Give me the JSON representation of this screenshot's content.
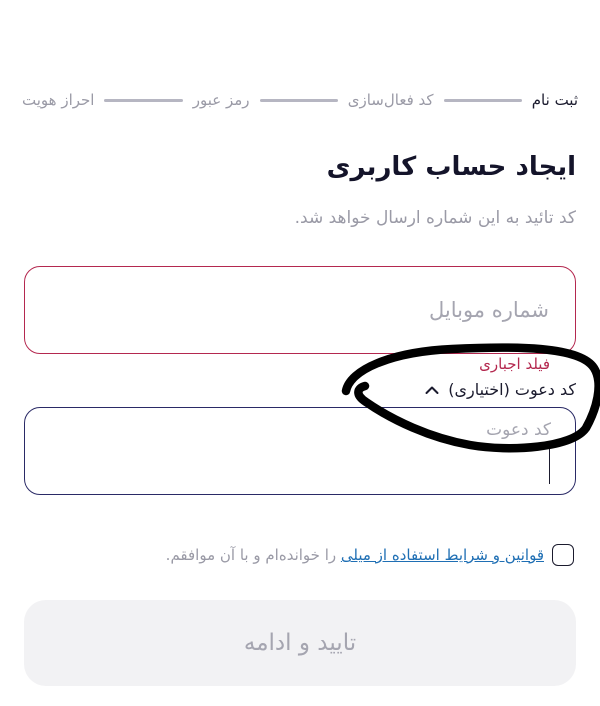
{
  "stepper": {
    "steps": [
      "ثبت نام",
      "کد فعال‌سازی",
      "رمز عبور",
      "احراز هویت"
    ]
  },
  "header": {
    "title": "ایجاد حساب کاربری",
    "subtitle": "کد تائید به این شماره ارسال خواهد شد."
  },
  "mobile": {
    "placeholder": "شماره موبایل",
    "error": "فیلد اجباری"
  },
  "invite": {
    "toggle_label": "کد دعوت (اختیاری)",
    "placeholder": "کد دعوت"
  },
  "terms": {
    "link_text": "قوانین و شرایط استفاده از میلی",
    "text": " را خوانده‌ام و با آن موافقم."
  },
  "submit": {
    "label": "تایید و ادامه"
  },
  "colors": {
    "error": "#b4284f",
    "link": "#1f6fb4",
    "focus_border": "#2a2a66",
    "disabled_button_bg": "#f2f2f4"
  }
}
